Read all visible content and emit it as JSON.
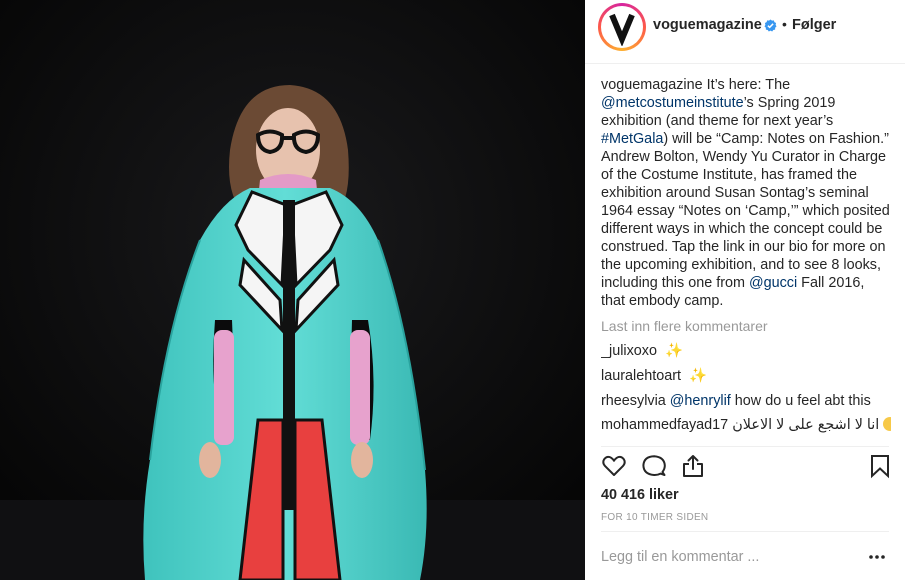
{
  "post": {
    "image_alt": "Model on runway wearing turquoise Gucci cape",
    "header": {
      "username": "voguemagazine",
      "separator": "•",
      "follow_label": "Følger"
    },
    "caption": {
      "author": "voguemagazine",
      "text_1": " It’s here: The ",
      "mention_1": "@metcostumeinstitute",
      "text_2": "’s Spring 2019 exhibition (and theme for next year’s ",
      "hashtag": "#MetGala",
      "text_3": ") will be “Camp: Notes on Fashion.” Andrew Bolton, Wendy Yu Curator in Charge of the Costume Institute, has framed the exhibition around Susan Sontag’s seminal 1964 essay “Notes on ‘Camp,’” which posited different ways in which the concept could be construed. Tap the link in our bio for more on the upcoming exhibition, and to see 8 looks, including this one from ",
      "mention_2": "@gucci",
      "text_4": " Fall 2016, that embody camp."
    },
    "load_more": "Last inn flere kommentarer",
    "comments": [
      {
        "user": "_julixoxo",
        "text": "",
        "emoji": "✨"
      },
      {
        "user": "lauralehtoart",
        "text": "",
        "emoji": "✨"
      },
      {
        "user": "rheesylvia",
        "mention": "@henrylif",
        "text": " how do u feel abt this"
      },
      {
        "user": "mohammedfayad17",
        "text": "انا لا اشجع على لا الاعلان"
      }
    ],
    "likes": "40 416 liker",
    "timestamp": "FOR 10 TIMER SIDEN",
    "add_comment_placeholder": "Legg til en kommentar ..."
  },
  "icons": {
    "like": "heart-icon",
    "comment": "comment-icon",
    "share": "share-icon",
    "save": "bookmark-icon",
    "options": "more-options-icon",
    "verified": "verified-badge-icon"
  },
  "colors": {
    "link": "#003569",
    "muted": "#999999",
    "verified": "#3897f0",
    "cape": "#55d6d0"
  }
}
